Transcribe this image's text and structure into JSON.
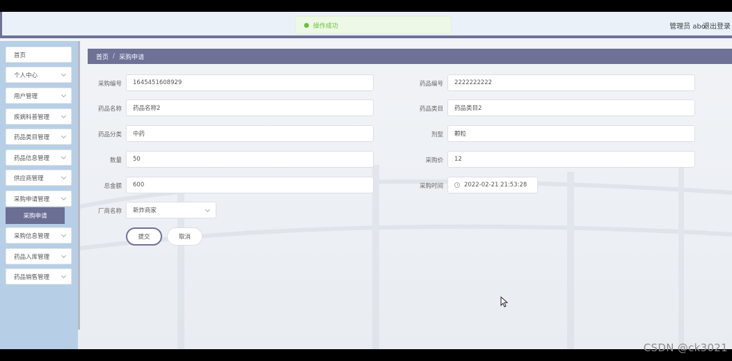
{
  "header": {
    "toast_text": "操作成功",
    "user_label": "管理员 abo",
    "logout_label": "退出登录"
  },
  "sidebar": {
    "items": [
      {
        "label": "首页"
      },
      {
        "label": "个人中心"
      },
      {
        "label": "用户管理"
      },
      {
        "label": "疾病科普管理"
      },
      {
        "label": "药品类目管理"
      },
      {
        "label": "药品信息管理"
      },
      {
        "label": "供应商管理"
      },
      {
        "label": "采购申请管理"
      },
      {
        "label": "采购信息管理"
      },
      {
        "label": "药品入库管理"
      },
      {
        "label": "药品销售管理"
      }
    ],
    "active_sub": "采购申请"
  },
  "breadcrumb": {
    "home": "首页",
    "separator": "/",
    "current": "采购申请"
  },
  "form": {
    "purchase_no_label": "采购编号",
    "purchase_no": "1645451608929",
    "drug_no_label": "药品编号",
    "drug_no": "2222222222",
    "drug_name_label": "药品名称",
    "drug_name": "药品名称2",
    "drug_category_label": "药品类目",
    "drug_category": "药品类目2",
    "drug_class_label": "药品分类",
    "drug_class": "中药",
    "dosage_form_label": "剂型",
    "dosage_form": "颗粒",
    "quantity_label": "数量",
    "quantity": "50",
    "unit_price_label": "采购价",
    "unit_price": "12",
    "total_label": "总金额",
    "total": "600",
    "purchase_time_label": "采购时间",
    "purchase_time": "2022-02-21 21:53:28",
    "vendor_label": "厂商名称",
    "vendor": "新炸商家",
    "submit_label": "提交",
    "cancel_label": "取消"
  },
  "watermark": "CSDN @ck3021",
  "colors": {
    "accent": "#6f7197",
    "sidebar_bg": "#b6cfe6",
    "success": "#67c23a"
  }
}
